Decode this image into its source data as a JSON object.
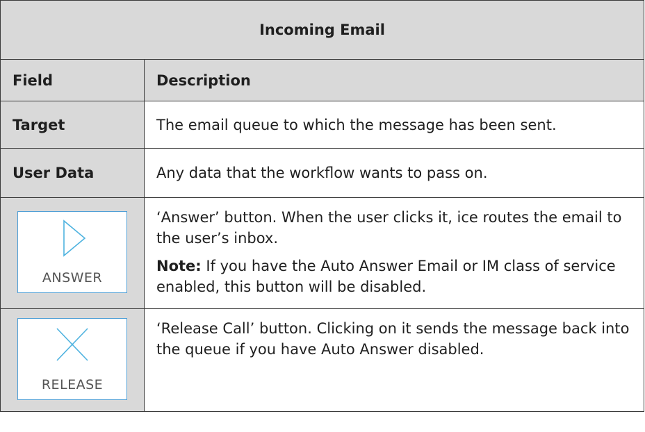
{
  "table": {
    "title": "Incoming Email",
    "header": {
      "field": "Field",
      "description": "Description"
    },
    "rows": [
      {
        "field": "Target",
        "description": "The email queue to which the message has been sent."
      },
      {
        "field": "User Data",
        "description": "Any data that the workflow wants to pass on."
      },
      {
        "icon": "play-icon",
        "button_label": "ANSWER",
        "description": "‘Answer’ button. When the user clicks it, ice routes the email to the user’s inbox.",
        "note_label": "Note:",
        "note_text": " If you have the Auto Answer Email or IM class of service enabled, this button will be disabled."
      },
      {
        "icon": "close-x-icon",
        "button_label": "RELEASE",
        "description": "‘Release Call’ button. Clicking on it sends the message back into the queue if you have Auto Answer disabled."
      }
    ]
  },
  "colors": {
    "header_bg": "#d9d9d9",
    "icon_blue": "#4f9fd6",
    "border": "#3a3a3a"
  }
}
